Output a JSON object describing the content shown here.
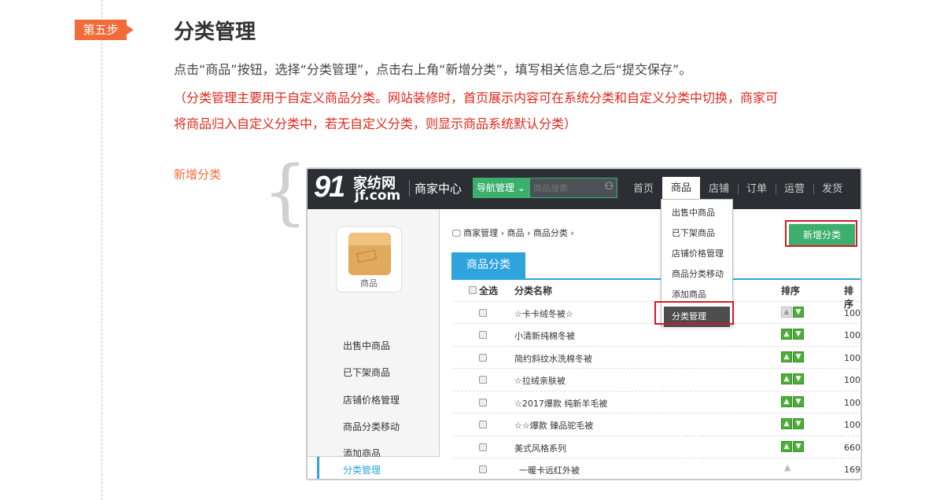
{
  "step": {
    "tag": "第五步",
    "title": "分类管理",
    "desc": "点击“商品”按钮，选择“分类管理”，点击右上角“新增分类”，填写相关信息之后“提交保存”。",
    "note_line1": "（分类管理主要用于自定义商品分类。网站装修时，首页展示内容可在系统分类和自定义分类中切换，商家可",
    "note_line2": "将商品归入自定义分类中，若无自定义分类，则显示商品系统默认分类）",
    "side_label": "新增分类"
  },
  "header": {
    "logo_num": "91",
    "logo_cn": "家纺网",
    "logo_en": "jf.com",
    "merchant_center": "商家中心",
    "nav_manage": "导航管理",
    "search_placeholder": "商品搜索",
    "nav": [
      "首页",
      "商品",
      "店铺",
      "订单",
      "运营",
      "发货"
    ]
  },
  "dropdown": [
    "出售中商品",
    "已下架商品",
    "店铺价格管理",
    "商品分类移动",
    "添加商品",
    "分类管理"
  ],
  "sidebar": {
    "product_label": "商品",
    "items": [
      "出售中商品",
      "已下架商品",
      "店铺价格管理",
      "商品分类移动",
      "添加商品",
      "分类管理"
    ]
  },
  "breadcrumb": [
    "商家管理",
    "商品",
    "商品分类"
  ],
  "new_button": "新增分类",
  "tab": "商品分类",
  "table": {
    "headers": [
      "全选",
      "分类名称",
      "排序",
      "排序"
    ],
    "rows": [
      {
        "name": "☆卡卡绒冬被☆",
        "num": "100"
      },
      {
        "name": "小清新纯棉冬被",
        "num": "100"
      },
      {
        "name": "简约斜纹水洗棉冬被",
        "num": "100"
      },
      {
        "name": "☆拉绒亲肤被",
        "num": "100"
      },
      {
        "name": "☆2017爆款 纯新羊毛被",
        "num": "100"
      },
      {
        "name": "☆☆爆款 臻品驼毛被",
        "num": "100"
      },
      {
        "name": "美式风格系列",
        "num": "660"
      },
      {
        "name": "一暖卡远红外被",
        "num": "169"
      }
    ]
  }
}
